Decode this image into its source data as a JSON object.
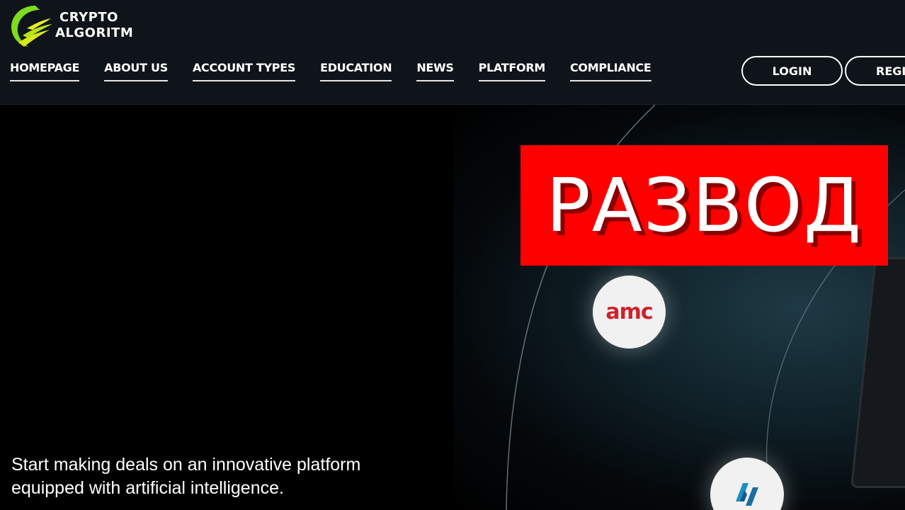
{
  "brand": {
    "line1": "CRYPTO",
    "line2": "ALGORITM",
    "colors": {
      "green": "#7ddc1f",
      "yellow": "#d8e81a"
    }
  },
  "nav": {
    "items": [
      "HOMEPAGE",
      "ABOUT US",
      "ACCOUNT TYPES",
      "EDUCATION",
      "NEWS",
      "PLATFORM",
      "COMPLIANCE"
    ]
  },
  "auth": {
    "login_label": "LOGIN",
    "register_label": "REGIS"
  },
  "overlay": {
    "label": "РАЗВОД",
    "color": "#ff0000"
  },
  "hero": {
    "line1": "Start making deals on an innovative platform",
    "line2": "equipped with artificial intelligence.",
    "amc_logo": "amc"
  }
}
